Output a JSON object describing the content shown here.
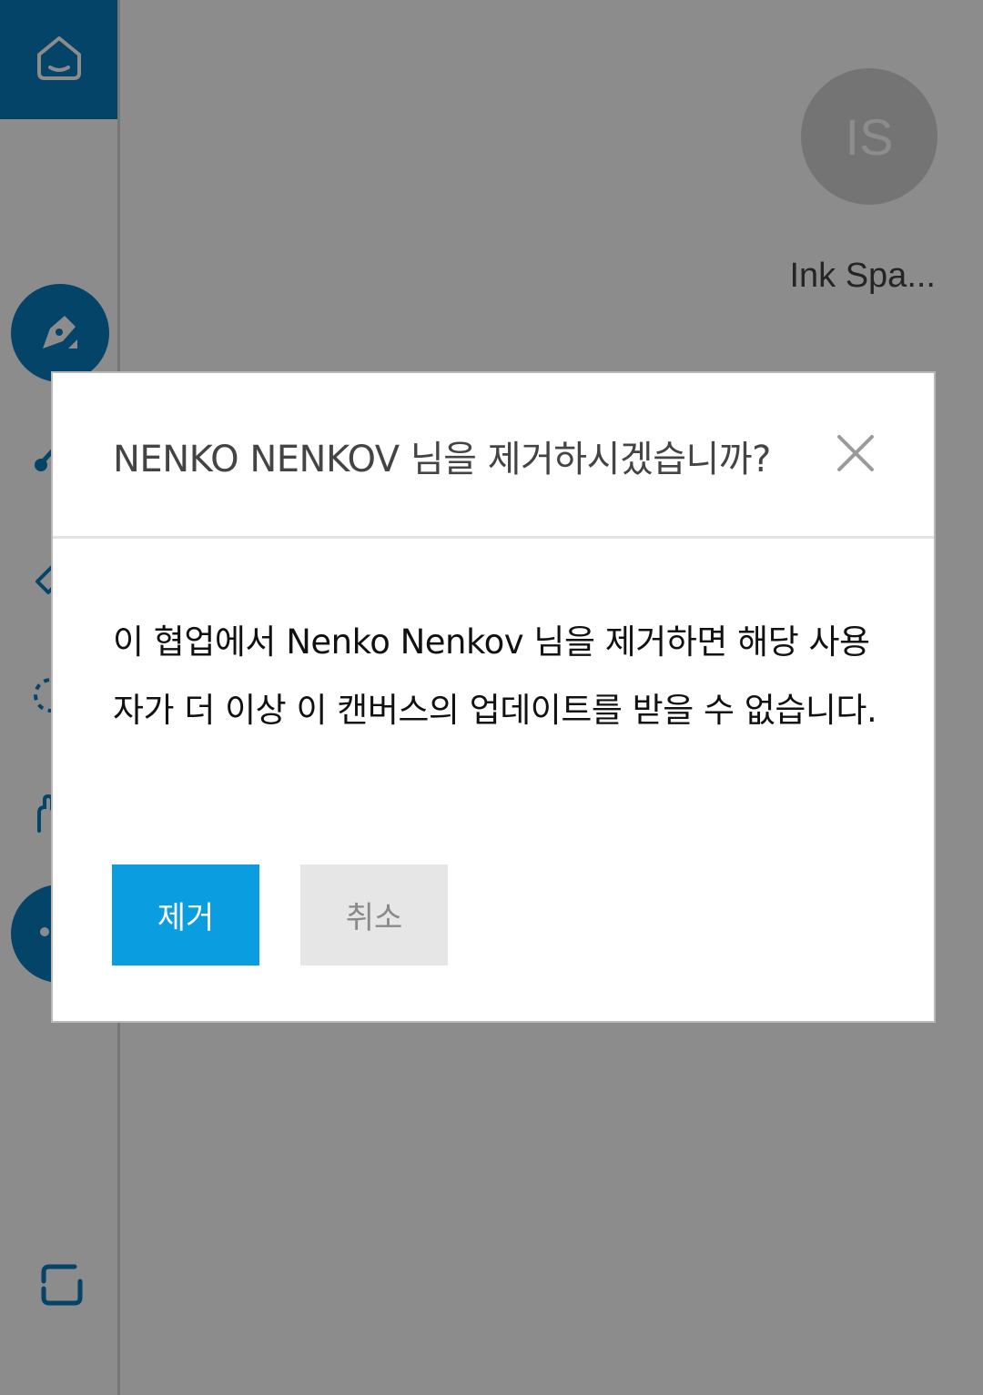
{
  "sidebar": {
    "icons": {
      "home": "home-icon",
      "pen": "pen-icon",
      "brush": "brush-icon",
      "eraser": "eraser-icon",
      "lasso": "lasso-icon",
      "hand": "hand-icon",
      "more": "more-icon",
      "fit": "fit-screen-icon"
    }
  },
  "main": {
    "avatar_initials": "IS",
    "canvas_name": "Ink Spa..."
  },
  "dialog": {
    "title": "NENKO NENKOV 님을 제거하시겠습니까?",
    "body": "이 협업에서 Nenko Nenkov 님을 제거하면 해당 사용자가 더 이상 이 캔버스의 업데이트를 받을 수 없습니다.",
    "remove_label": "제거",
    "cancel_label": "취소"
  },
  "colors": {
    "accent": "#0a7cbf",
    "primary_button": "#0a9de0",
    "secondary_button": "#e6e6e6",
    "overlay": "rgba(0,0,0,0.45)"
  }
}
